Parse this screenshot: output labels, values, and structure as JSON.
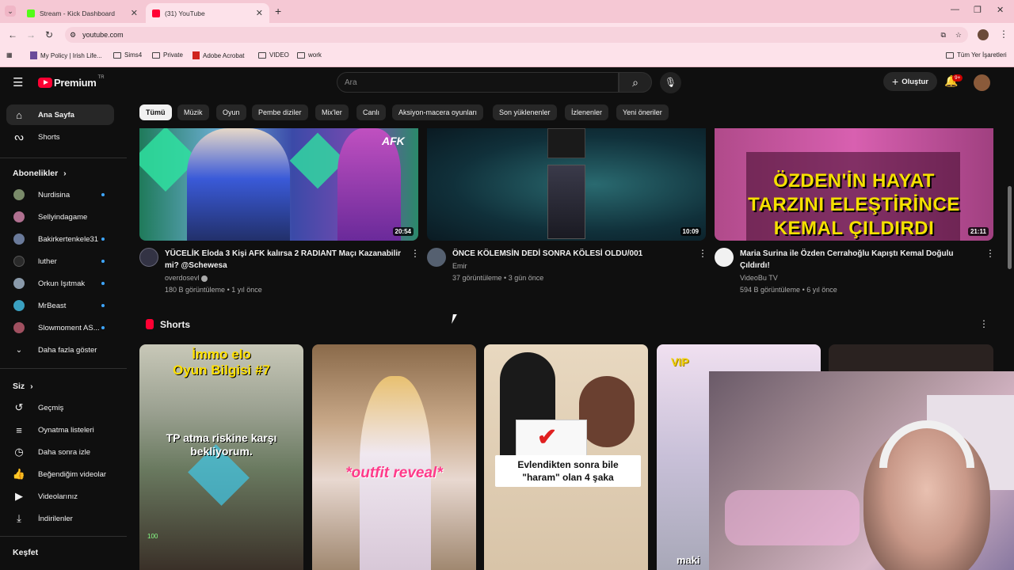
{
  "browser": {
    "tabs": [
      {
        "title": "Stream - Kick Dashboard",
        "favicon_color": "#53fc18"
      },
      {
        "title": "(31) YouTube",
        "favicon_color": "#ff0033"
      }
    ],
    "new_tab": "+",
    "url": "youtube.com",
    "bookmarks": [
      "My Policy | Irish Life...",
      "Sims4",
      "Private",
      "Adobe Acrobat",
      "VIDEO",
      "work"
    ],
    "all_bookmarks": "Tüm Yer İşaretleri"
  },
  "header": {
    "logo_text": "Premium",
    "logo_region": "TR",
    "search_placeholder": "Ara",
    "create_label": "Oluştur",
    "notif_badge": "9+"
  },
  "sidebar": {
    "main": [
      {
        "label": "Ana Sayfa",
        "icon": "home-icon"
      },
      {
        "label": "Shorts",
        "icon": "shorts-icon"
      }
    ],
    "subscriptions_title": "Abonelikler",
    "subscriptions": [
      {
        "name": "Nurdisina",
        "color": "#7a8b6a"
      },
      {
        "name": "Sellyindagame",
        "color": "#b07090"
      },
      {
        "name": "Bakirkertenkele31",
        "color": "#6a7a9a"
      },
      {
        "name": "luther",
        "color": "#2a2a2a"
      },
      {
        "name": "Orkun Işıtmak",
        "color": "#8a9aaa"
      },
      {
        "name": "MrBeast",
        "color": "#3aa0c0"
      },
      {
        "name": "Slowmoment AS...",
        "color": "#a05060"
      }
    ],
    "show_more": "Daha fazla göster",
    "you_title": "Siz",
    "you": [
      {
        "label": "Geçmiş",
        "icon": "history-icon"
      },
      {
        "label": "Oynatma listeleri",
        "icon": "playlist-icon"
      },
      {
        "label": "Daha sonra izle",
        "icon": "clock-icon"
      },
      {
        "label": "Beğendiğim videolar",
        "icon": "thumbs-up-icon"
      },
      {
        "label": "Videolarınız",
        "icon": "video-icon"
      },
      {
        "label": "İndirilenler",
        "icon": "download-icon"
      }
    ],
    "explore_title": "Keşfet"
  },
  "chips": [
    "Tümü",
    "Müzik",
    "Oyun",
    "Pembe diziler",
    "Mix'ler",
    "Canlı",
    "Aksiyon-macera oyunları",
    "Son yüklenenler",
    "İzlenenler",
    "Yeni öneriler"
  ],
  "videos": [
    {
      "title_l1": "YÜCELİK Eloda 3 Kişi AFK kalırsa 2 RADIANT Maçı Kazanabilir",
      "title_l2": "mi? @Schewesa",
      "channel": "overdosevl",
      "views": "180 B görüntüleme",
      "age": "1 yıl önce",
      "duration": "20:54",
      "overlay": "AFK"
    },
    {
      "title_l1": "ÖNCE KÖLEMSİN DEDİ SONRA KÖLESİ OLDU/001",
      "title_l2": "",
      "channel": "Emir",
      "views": "37 görüntüleme",
      "age": "3 gün önce",
      "duration": "10:09",
      "overlay": ""
    },
    {
      "title_l1": "Maria Surina ile Özden Cerrahoğlu Kapıştı Kemal Doğulu",
      "title_l2": "Çıldırdı!",
      "channel": "VideoBu TV",
      "views": "594 B görüntüleme",
      "age": "6 yıl önce",
      "duration": "21:11",
      "overlay": "ÖZDEN'İN HAYAT TARZINI ELEŞTİRİNCE KEMAL ÇILDIRDI"
    }
  ],
  "shorts": {
    "title": "Shorts",
    "items": [
      {
        "caption_top": "İmmo elo",
        "caption_top2": "Oyun Bilgisi #7",
        "caption_mid": "TP atma riskine karşı bekliyorum.",
        "hud": "100"
      },
      {
        "caption_mid": "*outfit reveal*"
      },
      {
        "caption_mid": "Evlendikten sonra bile \"haram\" olan 4 şaka"
      },
      {
        "caption_top": "VIP",
        "caption_bottom": "maki"
      }
    ]
  }
}
